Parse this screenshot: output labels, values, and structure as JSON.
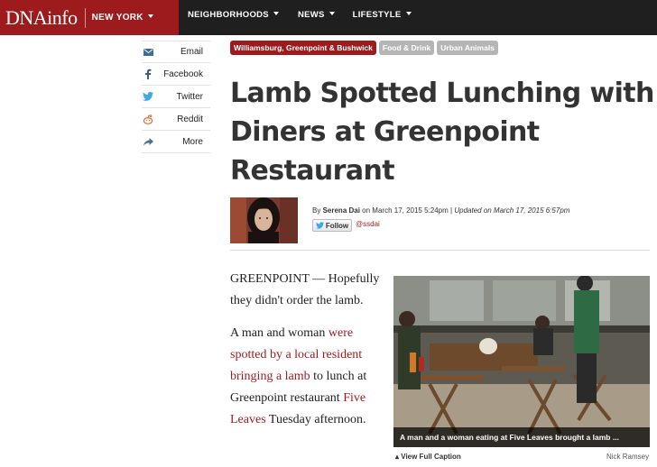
{
  "header": {
    "logo": "DNAinfo",
    "city": "NEW YORK",
    "nav": [
      {
        "label": "NEIGHBORHOODS"
      },
      {
        "label": "NEWS"
      },
      {
        "label": "LIFESTYLE"
      }
    ]
  },
  "share": [
    {
      "label": "Email",
      "icon": "envelope-icon"
    },
    {
      "label": "Facebook",
      "icon": "facebook-icon"
    },
    {
      "label": "Twitter",
      "icon": "twitter-icon"
    },
    {
      "label": "Reddit",
      "icon": "reddit-icon"
    },
    {
      "label": "More",
      "icon": "share-arrow-icon"
    }
  ],
  "tags": [
    {
      "label": "Williamsburg, Greenpoint & Bushwick",
      "color": "#9d1a1d"
    },
    {
      "label": "Food & Drink",
      "color": "#b5b5b5"
    },
    {
      "label": "Urban Animals",
      "color": "#b5b5b5"
    }
  ],
  "article": {
    "headline": "Lamb Spotted Lunching with Diners at Greenpoint Restaurant",
    "byline": {
      "by": "By",
      "author": "Serena Dai",
      "on": "on March 17, 2015 5:24pm",
      "separator": "|",
      "updated": "Updated on March 17, 2015 6:57pm"
    },
    "follow_label": "Follow",
    "handle": "@ssdai",
    "p1": "GREENPOINT — Hopefully they didn't order the lamb.",
    "p2_before": "A man and woman ",
    "p2_link1": "were spotted by a local resident bringing a lamb",
    "p2_middle": " to lunch at Greenpoint restaurant ",
    "p2_link2": "Five Leaves",
    "p2_after": " Tuesday afternoon."
  },
  "photo": {
    "caption": "A man and a woman eating at Five Leaves brought a lamb ...",
    "view_full_caption": "View Full Caption",
    "credit": "Nick Ramsey"
  },
  "colors": {
    "brand_red": "#9d1a1d",
    "nav_dark": "#1f1f1f"
  }
}
